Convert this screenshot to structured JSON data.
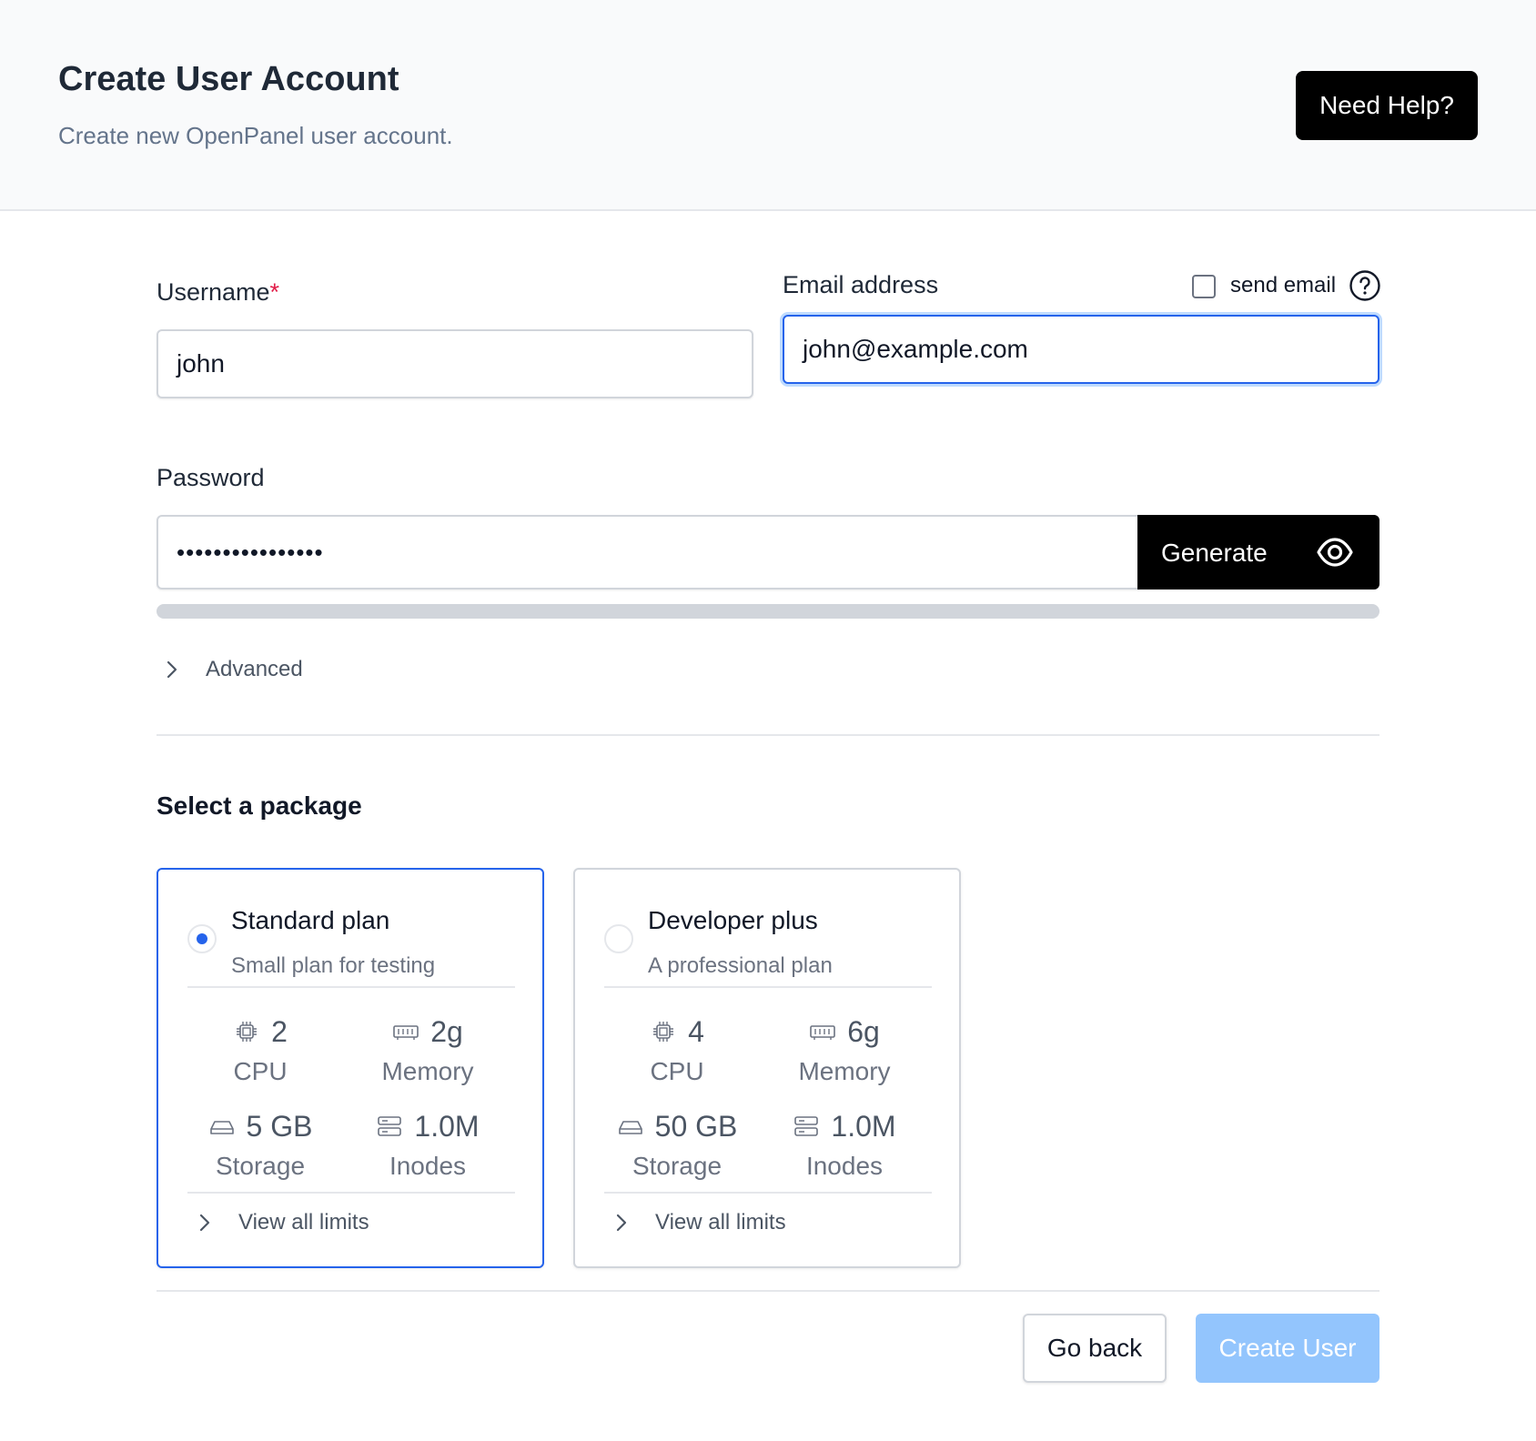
{
  "header": {
    "title": "Create User Account",
    "subtitle": "Create new OpenPanel user account.",
    "help_button": "Need Help?"
  },
  "form": {
    "username": {
      "label": "Username",
      "required_mark": "*",
      "value": "john"
    },
    "email": {
      "label": "Email address",
      "value": "john@example.com",
      "send_email_label": "send email",
      "send_email_checked": false
    },
    "password": {
      "label": "Password",
      "masked_value": "••••••••••••••••",
      "generate_label": "Generate",
      "strength_percent": 0
    },
    "advanced_label": "Advanced"
  },
  "packages": {
    "title": "Select a package",
    "items": [
      {
        "name": "Standard plan",
        "description": "Small plan for testing",
        "selected": true,
        "cpu": {
          "value": "2",
          "label": "CPU",
          "icon": "cpu-icon"
        },
        "memory": {
          "value": "2g",
          "label": "Memory",
          "icon": "memory-icon"
        },
        "storage": {
          "value": "5 GB",
          "label": "Storage",
          "icon": "hard-drive-icon"
        },
        "inodes": {
          "value": "1.0M",
          "label": "Inodes",
          "icon": "server-icon"
        },
        "view_limits": "View all limits"
      },
      {
        "name": "Developer plus",
        "description": "A professional plan",
        "selected": false,
        "cpu": {
          "value": "4",
          "label": "CPU",
          "icon": "cpu-icon"
        },
        "memory": {
          "value": "6g",
          "label": "Memory",
          "icon": "memory-icon"
        },
        "storage": {
          "value": "50 GB",
          "label": "Storage",
          "icon": "hard-drive-icon"
        },
        "inodes": {
          "value": "1.0M",
          "label": "Inodes",
          "icon": "server-icon"
        },
        "view_limits": "View all limits"
      }
    ]
  },
  "actions": {
    "back": "Go back",
    "create": "Create User"
  },
  "colors": {
    "accent": "#2563eb",
    "disabled_primary": "#93c5fd",
    "dark_button": "#000000"
  }
}
